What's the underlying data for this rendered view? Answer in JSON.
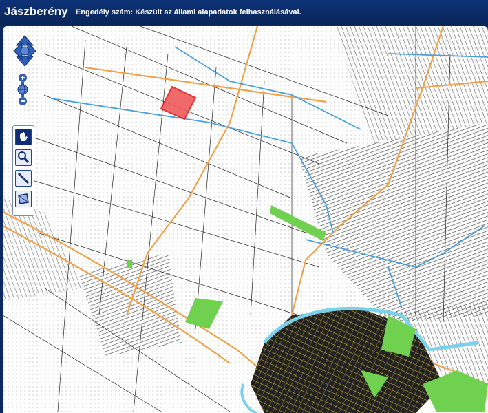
{
  "header": {
    "title": "Jászberény",
    "subtitle": "Engedély szám:  Készült az állami alapadatok felhasználásával."
  },
  "colors": {
    "header_bg": "#0b2a63",
    "parcel_lines": "#222222",
    "roads": "#f0a24a",
    "water": "#4aa0d8",
    "green_areas": "#6fd14f",
    "selected_parcel": "#f05a5a",
    "town_core": "#1a1a1a"
  },
  "controls": {
    "pan": {
      "icon": "pan-arrows-icon"
    },
    "zoom_in": {
      "icon": "plus-icon"
    },
    "zoom_world": {
      "icon": "globe-icon"
    },
    "zoom_out": {
      "icon": "minus-icon"
    },
    "tools": [
      {
        "name": "hand-pan-tool",
        "icon": "hand-icon",
        "active": true
      },
      {
        "name": "zoom-box-tool",
        "icon": "magnifier-icon",
        "active": false
      },
      {
        "name": "measure-line-tool",
        "icon": "ruler-icon",
        "active": false
      },
      {
        "name": "measure-area-tool",
        "icon": "area-icon",
        "active": false
      }
    ]
  }
}
